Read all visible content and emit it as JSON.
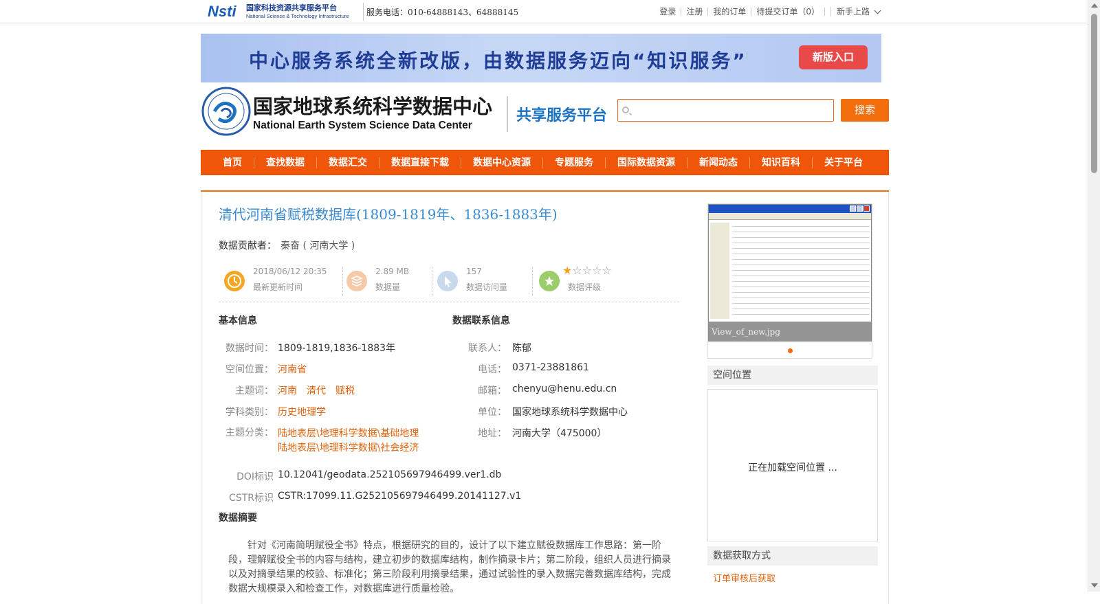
{
  "topbar": {
    "service_phone": "服务电话：010-64888143、64888145",
    "links": [
      "登录",
      "注册",
      "我的订单",
      "待提交订单（0）"
    ],
    "guide": "新手上路",
    "nsti_cn": "国家科技资源共享服务平台",
    "nsti_en": "National Science & Technology Infrastructure"
  },
  "banner": {
    "text": "中心服务系统全新改版，由数据服务迈向“知识服务”",
    "button": "新版入口"
  },
  "header": {
    "center_name_cn": "国家地球系统科学数据中心",
    "center_name_en": "National Earth System Science Data Center",
    "platform": "共享服务平台",
    "search_placeholder": "",
    "search_button": "搜索"
  },
  "nav": {
    "items": [
      "首页",
      "查找数据",
      "数据汇交",
      "数据直接下载",
      "数据中心资源",
      "专题服务",
      "国际数据资源",
      "新闻动态",
      "知识百科",
      "关于平台"
    ]
  },
  "dataset": {
    "title": "清代河南省赋税数据库(1809-1819年、1836-1883年)",
    "contributor_label": "数据贡献者：",
    "contributor": "秦奋 ( 河南大学 )",
    "stats": {
      "update_time": "2018/06/12 20:35",
      "update_time_label": "最新更新时间",
      "size": "2.89 MB",
      "size_label": "数据量",
      "visits": "157",
      "visits_label": "数据访问量",
      "rating": 1,
      "rating_max": 5,
      "rating_label": "数据评级"
    }
  },
  "basic_info": {
    "heading": "基本信息",
    "time_label": "数据时间：",
    "time": "1809-1819,1836-1883年",
    "location_label": "空间位置：",
    "location": "河南省",
    "keywords_label": "主题词：",
    "keywords": [
      "河南",
      "清代",
      "赋税"
    ],
    "discipline_label": "学科类别：",
    "discipline": "历史地理学",
    "category_label": "主题分类：",
    "categories": [
      "陆地表层\\地理科学数据\\基础地理",
      "陆地表层\\地理科学数据\\社会经济"
    ],
    "doi_label": "DOI标识",
    "doi": "10.12041/geodata.252105697946499.ver1.db",
    "cstr_label": "CSTR标识",
    "cstr": "CSTR:17099.11.G252105697946499.20141127.v1"
  },
  "contact_info": {
    "heading": "数据联系信息",
    "contact_label": "联系人：",
    "contact": "陈郁",
    "phone_label": "电话：",
    "phone": "0371-23881861",
    "email_label": "邮箱：",
    "email": "chenyu@henu.edu.cn",
    "unit_label": "单位：",
    "unit": "国家地球系统科学数据中心",
    "address_label": "地址：",
    "address": "河南大学（475000）"
  },
  "abstract": {
    "heading": "数据摘要",
    "text": "针对《河南简明赋役全书》特点，根据研究的目的，设计了以下建立赋役数据库工作思路：第一阶段，理解赋役全书的内容与结构，建立初步的数据库结构，制作摘录卡片；第二阶段，组织人员进行摘录以及对摘录结果的校验、标准化；第三阶段利用摘录结果，通过试验性的录入数据完善数据库结构，完成数据大规模录入和检查工作，对数据库进行质量检验。"
  },
  "sidebar": {
    "preview_caption": "View_of_new.jpg",
    "spatial_heading": "空间位置",
    "map_loading": "正在加载空间位置 ...",
    "acquire_heading": "数据获取方式",
    "acquire_method": "订单审核后获取"
  },
  "colors": {
    "accent": "#f26d0c",
    "title_blue": "#3b8bd0",
    "link_orange": "#e2640e"
  }
}
